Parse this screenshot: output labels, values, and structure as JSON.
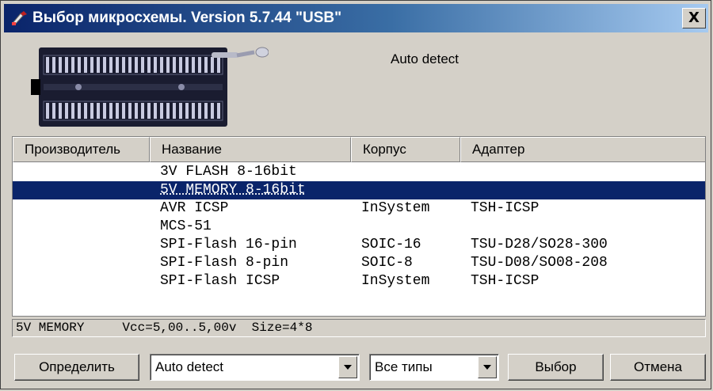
{
  "window": {
    "title": "Выбор микросхемы. Version  5.7.44 \"USB\"",
    "close_glyph": "X",
    "icon": "programmer-tool-icon"
  },
  "banner": {
    "detect_label": "Auto detect",
    "image": "zif-socket-icon"
  },
  "table": {
    "columns": [
      "Производитель",
      "Название",
      "Корпус",
      "Адаптер"
    ],
    "rows": [
      {
        "manufacturer": "",
        "model": "3V FLASH 8-16bit",
        "package": "",
        "adapter": "",
        "selected": false
      },
      {
        "manufacturer": "",
        "model": "5V MEMORY 8-16bit",
        "package": "",
        "adapter": "",
        "selected": true
      },
      {
        "manufacturer": "",
        "model": "AVR ICSP",
        "package": "InSystem",
        "adapter": "TSH-ICSP",
        "selected": false
      },
      {
        "manufacturer": "",
        "model": "MCS-51",
        "package": "",
        "adapter": "",
        "selected": false
      },
      {
        "manufacturer": "",
        "model": "SPI-Flash 16-pin",
        "package": "SOIC-16",
        "adapter": "TSU-D28/SO28-300",
        "selected": false
      },
      {
        "manufacturer": "",
        "model": "SPI-Flash 8-pin",
        "package": "SOIC-8",
        "adapter": "TSU-D08/SO08-208",
        "selected": false
      },
      {
        "manufacturer": "",
        "model": "SPI-Flash ICSP",
        "package": "InSystem",
        "adapter": "TSH-ICSP",
        "selected": false
      }
    ]
  },
  "status": {
    "text": "5V MEMORY     Vcc=5,00..5,00v  Size=4*8"
  },
  "footer": {
    "detect_button": "Определить",
    "mode_combo": "Auto detect",
    "type_combo": "Все типы",
    "select_button": "Выбор",
    "cancel_button": "Отмена"
  },
  "colors": {
    "face": "#d4d0c8",
    "title_start": "#0a246a",
    "title_end": "#a6caf0",
    "selection": "#0a246a"
  }
}
